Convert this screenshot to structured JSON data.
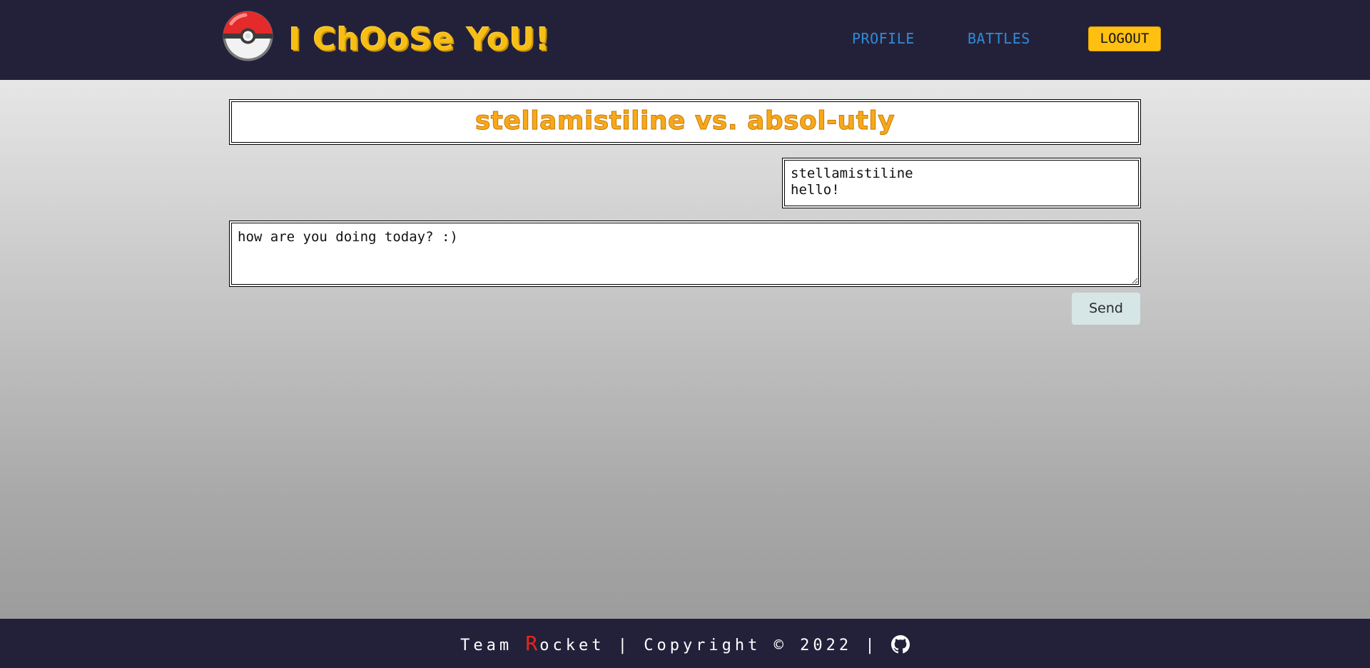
{
  "header": {
    "brand": "I ChOoSe YoU!",
    "nav": {
      "profile": "PROFILE",
      "battles": "BATTLES",
      "logout": "LOGOUT"
    },
    "logo_icon": "pokeball-icon"
  },
  "battle": {
    "title": "stellamistiline vs. absol-utly",
    "messages": [
      {
        "author": "stellamistiline",
        "text": "hello!"
      }
    ],
    "composer_value": "how are you doing today? :)",
    "send_label": "Send"
  },
  "footer": {
    "team_prefix": "Team ",
    "team_initial": "R",
    "team_rest": "ocket",
    "separator1": " | ",
    "copyright": "Copyright © 2022",
    "separator2": " | ",
    "github_icon": "github-icon"
  },
  "colors": {
    "nav_bg": "#23213a",
    "brand_yellow": "#f7be16",
    "link_blue": "#2e8bd6",
    "logout_bg": "#ffc012",
    "title_orange": "#f7a81b",
    "send_bg": "#d6e6e6",
    "rocket_red": "#e8261b"
  }
}
